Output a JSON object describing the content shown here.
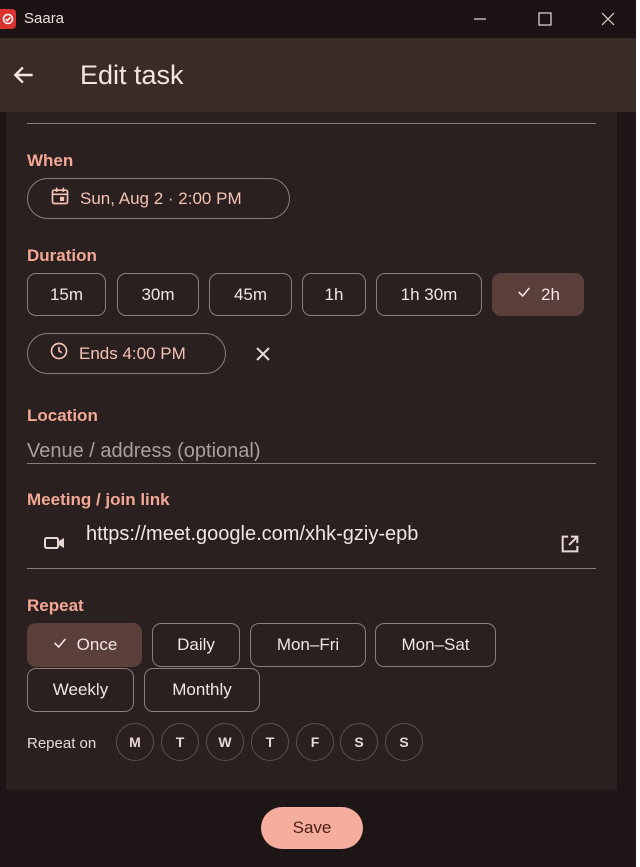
{
  "window": {
    "title": "Saara"
  },
  "appbar": {
    "title": "Edit task"
  },
  "when": {
    "label": "When",
    "datetime": "Sun, Aug 2 · 2:00 PM"
  },
  "duration": {
    "label": "Duration",
    "options": [
      "15m",
      "30m",
      "45m",
      "1h",
      "1h 30m",
      "2h"
    ],
    "selected": "2h",
    "ends": "Ends 4:00 PM"
  },
  "location": {
    "label": "Location",
    "placeholder": "Venue / address (optional)"
  },
  "meeting": {
    "label": "Meeting / join link",
    "value": "https://meet.google.com/xhk-gziy-epb"
  },
  "repeat": {
    "label": "Repeat",
    "options": [
      "Once",
      "Daily",
      "Mon–Fri",
      "Mon–Sat",
      "Weekly",
      "Monthly"
    ],
    "selected": "Once",
    "repeat_on_label": "Repeat on",
    "days": [
      "M",
      "T",
      "W",
      "T",
      "F",
      "S",
      "S"
    ]
  },
  "actions": {
    "save_label": "Save"
  },
  "colors": {
    "accent": "#f2a895",
    "selected_chip": "#5a3f3a",
    "save_button": "#f5ad9d",
    "background": "#2a2020"
  }
}
